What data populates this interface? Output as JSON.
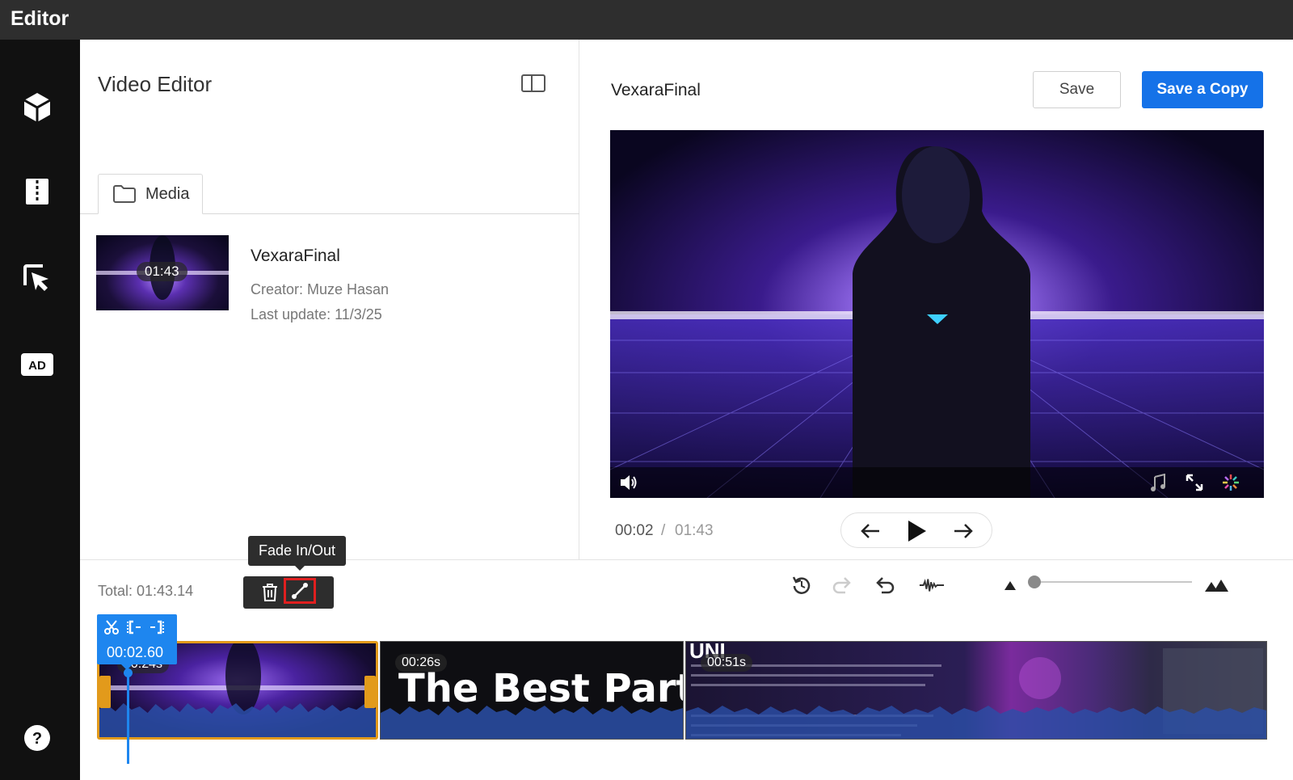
{
  "app": {
    "title": "Editor"
  },
  "rail": {
    "items": [
      {
        "icon": "cube-icon"
      },
      {
        "icon": "split-icon"
      },
      {
        "icon": "cursor-icon"
      },
      {
        "icon": "ad-icon",
        "label": "AD"
      },
      {
        "icon": "help-icon",
        "label": "?"
      }
    ]
  },
  "left_panel": {
    "title": "Video Editor",
    "tabs": [
      {
        "label": "Media",
        "icon": "folder-icon"
      }
    ],
    "media": {
      "name": "VexaraFinal",
      "duration": "01:43",
      "creator": "Creator: Muze Hasan",
      "updated": "Last update: 11/3/25"
    }
  },
  "right_panel": {
    "title": "VexaraFinal",
    "save_label": "Save",
    "save_copy_label": "Save a Copy",
    "time_current": "00:02",
    "time_sep": "/",
    "time_total": "01:43"
  },
  "timeline": {
    "total": "Total: 01:43.14",
    "tooltip": "Fade In/Out",
    "cut_time": "00:02.60",
    "clips": [
      {
        "badge": "00:24s"
      },
      {
        "badge": "00:26s",
        "overlay_text": "The Best Part"
      },
      {
        "badge": "00:51s",
        "overlay_text": "UNI"
      }
    ],
    "zoom_level": 0.0
  },
  "colors": {
    "accent": "#1572e8",
    "selected_clip": "#e29a1b",
    "highlight": "#e01f1f",
    "topbar": "#2e2e2e"
  }
}
